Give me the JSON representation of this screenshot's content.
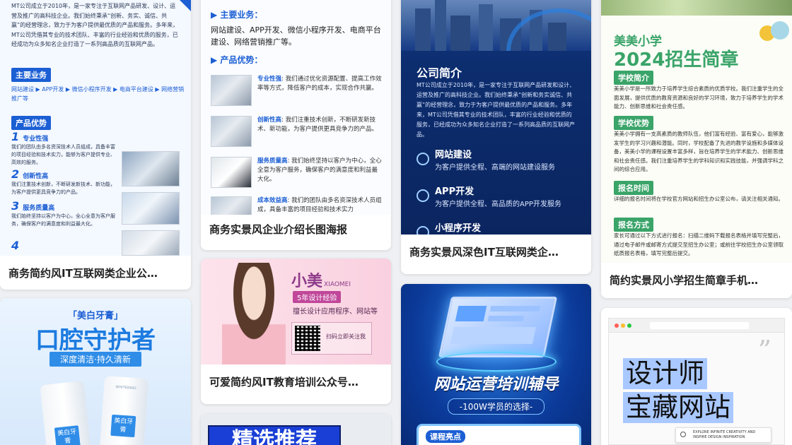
{
  "cards": {
    "c1": {
      "caption": "商务简约风IT互联网类企业公…",
      "intro": "MT公司成立于2010年，是一家专注于互联网产品研发、设计、运营及推广的高科技企业。我们始终秉承“创新、务实、诚信、共赢”的经营理念，致力于为客户提供最优质的产品和服务。多年来，MT公司凭借其专业的技术团队、丰富的行业经验和优质的服务，已经成功为众多知名企业打造了一系列高品质的互联网产品。",
      "tag_business": "主要业务",
      "business_list": "网站建设 ▶ APP开发 ▶ 微信小程序开发 ▶ 电商平台建设 ▶ 网络营销推广等",
      "tag_adv": "产品优势",
      "adv1_title": "专业性强",
      "adv1_num": "1",
      "adv1_text": "我们的团队由多名资深技术人员组成，具备丰富的项目经验和技术实力，能够为客户提供专业、高效的服务。",
      "adv2_title": "创新性高",
      "adv2_num": "2",
      "adv2_text": "我们注重技术创新，不断研发新技术、新功能，为客户提供更具竞争力的产品。",
      "adv3_title": "服务质量高",
      "adv3_num": "3",
      "adv3_text": "我们始终坚持以客户为中心，全心全意为客户服务，确保客户的满意度和利益最大化。",
      "adv4_num": "4"
    },
    "c2": {
      "caption": "商务实景风企业介绍长图海报",
      "business_head": "主要业务：",
      "business_text": "网站建设、APP开发、微信小程序开发、电商平台建设、网络营销推广等。",
      "adv_head": "产品优势：",
      "items": [
        {
          "title": "专业性强",
          "text": "我们通过优化资源配置、提高工作效率等方式，降低客户的成本，实现合作共赢。"
        },
        {
          "title": "创新性高",
          "text": "我们注重技术创新，不断研发新技术、新功能，为客户提供更具竞争力的产品。"
        },
        {
          "title": "服务质量高",
          "text": "我们始终坚持以客户为中心，全心全意为客户服务，确保客户的满意度和利益最大化。"
        },
        {
          "title": "成本效益高",
          "text": "我们的团队由多名资深技术人员组成，具备丰富的项目经验和技术实力"
        }
      ]
    },
    "c3": {
      "caption": "商务实景风深色IT互联网类企…",
      "title": "公司简介",
      "intro": "MT公司成立于2010年，是一家专注于互联网产品研发和设计、运营及推广的高科技企业。我们始终秉承“创新和务实诚信、共赢”的经营理念，致力于为客户提供最优质的产品和服务。多年来，MT公司凭借其专业的技术团队，丰富的行业经验和优质的服务，已经成功为众多知名企业打造了一系列高品质的互联网产品。",
      "svc1_title": "网站建设",
      "svc1_text": "为客户提供全程、高端的网站建设服务",
      "svc2_title": "APP开发",
      "svc2_text": "为客户提供全程、高品质的APP开发服务",
      "svc3_title": "小程序开发"
    },
    "c4": {
      "caption": "简约实景风小学招生简章手机…",
      "school": "美美小学",
      "headline": "2024招生简章",
      "sec1": "学校简介",
      "sec1_text": "美美小学是一所致力于培养学生综合素质的优质学校。我们注重学生的全面发展，提供优质的教育资源和良好的学习环境，致力于培养学生的学术能力、创新思维和社会责任感。",
      "sec2": "学校优势",
      "sec2_text": "美美小学拥有一支高素质的教师队伍，他们富有经验、富有爱心，能够激发学生的学习兴趣和潜能。同时，学校配备了先进的教学设施和多媒体设备，美美小学的课程设置丰富多样，旨在培养学生的学术能力、创新思维和社会责任感。我们注重培养学生的学科知识和实践技能，并强调学科之间的综合应用。",
      "sec3": "报名时间",
      "sec3_text": "详细的报名时间将在学校官方网站和招生办公室公布，请关注相关通知。",
      "sec4": "报名方式",
      "sec4_text": "家长可通过以下方式进行报名：扫描二维码下载报名表格并填写完整后，通过电子邮件或邮寄方式提交至招生办公室；或前往学校招生办公室领取纸质报名表格，填写完整后提交。"
    },
    "c5": {
      "brand": "「美白牙膏」",
      "title": "口腔守护者",
      "sub": "深度清洁·持久清新",
      "tube1": "美白牙膏",
      "tube2": "美白牙膏",
      "tube_brand": "WHITENING"
    },
    "c6": {
      "caption": "可爱简约风IT教育培训公众号…",
      "name": "小美",
      "name_en": "XIAOMEI",
      "badge": "5年设计经验",
      "desc": "擅长设计应用程序、网站等",
      "qr_label": "扫码立即关注我"
    },
    "c7": {
      "title": "网站运营培训辅导",
      "sub": "-100W学员的选择-",
      "highlight": "课程亮点"
    },
    "c8": {
      "line1": "设计师",
      "line2": "宝藏网站",
      "quote": "”",
      "en1": "EXPLORE INFINITE CREATIVITY AND",
      "en2": "INSPIRE DESIGN INSPIRATION"
    },
    "c9": {
      "title": "精选推荐"
    }
  },
  "colors": {
    "blue": "#1c5fd4",
    "navy": "#0d2a6b",
    "green": "#3aa469",
    "pink": "#f7c7d9",
    "accent_yellow": "#f3c43a"
  }
}
